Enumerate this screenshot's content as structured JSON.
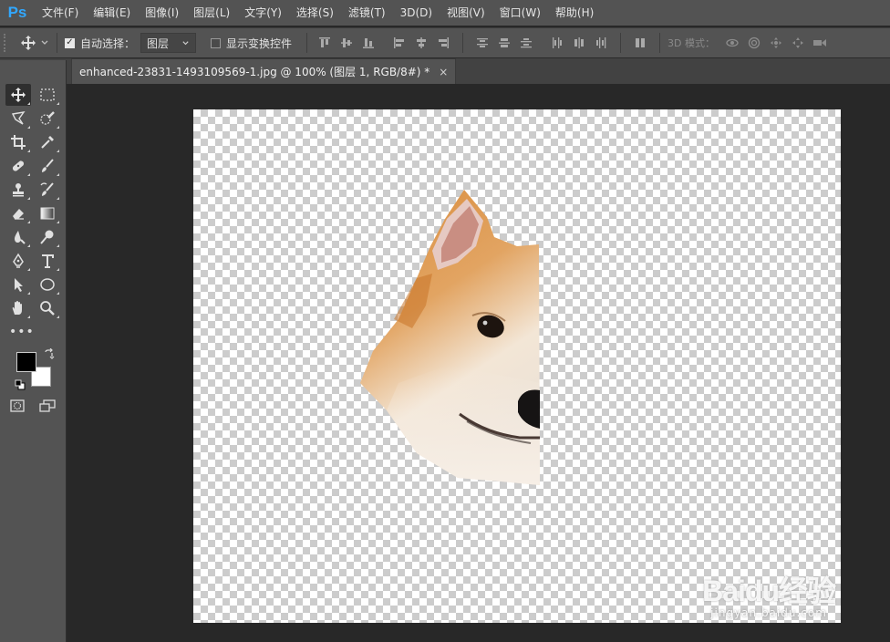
{
  "app": {
    "logo": "Ps"
  },
  "menu": [
    "文件(F)",
    "编辑(E)",
    "图像(I)",
    "图层(L)",
    "文字(Y)",
    "选择(S)",
    "滤镜(T)",
    "3D(D)",
    "视图(V)",
    "窗口(W)",
    "帮助(H)"
  ],
  "options": {
    "auto_select_label": "自动选择：",
    "auto_select_checked": true,
    "auto_select_value": "图层",
    "show_transform_label": "显示变换控件",
    "show_transform_checked": false,
    "mode_3d_label": "3D 模式："
  },
  "document": {
    "tab_title": "enhanced-23831-1493109569-1.jpg @ 100% (图层 1, RGB/8#) *",
    "close_glyph": "×"
  },
  "tools_panel": {
    "collapse_glyph": "◂◂",
    "more_glyph": "•••"
  },
  "colors": {
    "foreground": "#000000",
    "background": "#ffffff"
  },
  "watermark": {
    "main": "Baidu经验",
    "sub": "jingyan.baidu.com"
  }
}
